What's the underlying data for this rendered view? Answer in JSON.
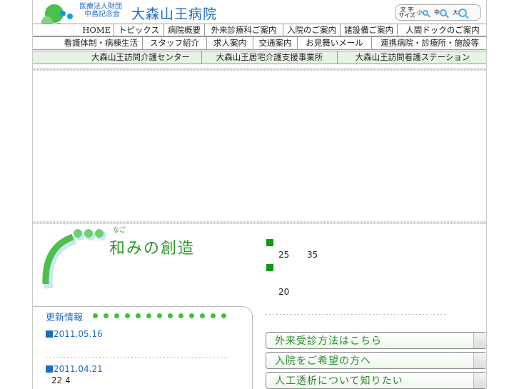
{
  "header": {
    "org_line1": "医療法人財団",
    "org_line2": "中島記念会",
    "hospital_name": "大森山王病院",
    "font_size_label": "文 字\nサイズ",
    "font_sizes": [
      "小",
      "中",
      "大"
    ]
  },
  "nav_main": [
    "HOME",
    "トピックス",
    "病院概要",
    "外来診療科ご案内",
    "入院のご案内",
    "諸設備ご案内",
    "人間ドックのご案内"
  ],
  "nav_sub": [
    "看護体制・病棟生活",
    "スタッフ紹介",
    "求人案内",
    "交通案内",
    "お見舞いメール",
    "連携病院・診療所・施設等"
  ],
  "nav_related": [
    "大森山王訪問介護センター",
    "大森山王居宅介護支援事業所",
    "大森山王訪問看護ステーション"
  ],
  "slogan": {
    "ruby": "なご",
    "text": "和みの創造",
    "info_numbers": [
      "25",
      "35",
      "20"
    ]
  },
  "news": {
    "title": "更新情報",
    "items": [
      {
        "date": "2011.05.16",
        "text": ""
      },
      {
        "date": "2011.04.21",
        "text": "22 4"
      }
    ]
  },
  "guide_buttons": [
    "外来受診方法はこちら",
    "入院をご希望の方へ",
    "人工透析について知りたい"
  ],
  "colors": {
    "brand_blue": "#1e6bc5",
    "brand_green": "#2a9a2a",
    "nav_related_bg": "#e7f3e4"
  }
}
